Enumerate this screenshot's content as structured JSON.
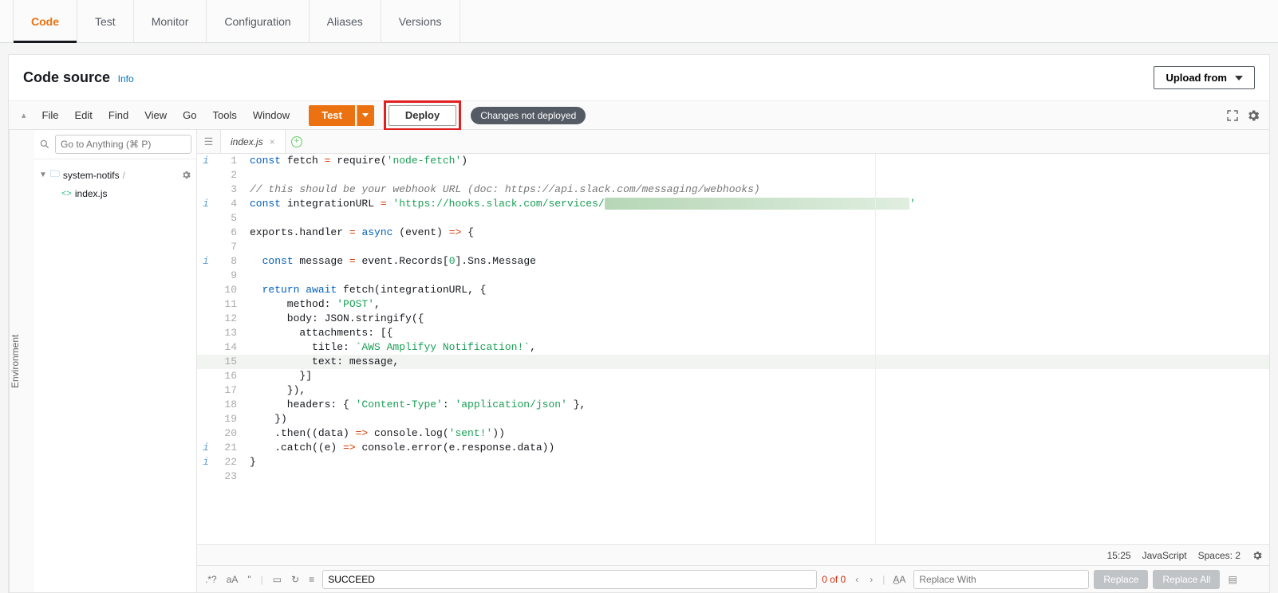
{
  "top_tabs": {
    "items": [
      "Code",
      "Test",
      "Monitor",
      "Configuration",
      "Aliases",
      "Versions"
    ],
    "active": "Code"
  },
  "panel": {
    "title": "Code source",
    "info_label": "Info",
    "upload_label": "Upload from"
  },
  "ide_menu": {
    "items": [
      "File",
      "Edit",
      "Find",
      "View",
      "Go",
      "Tools",
      "Window"
    ],
    "test_label": "Test",
    "deploy_label": "Deploy",
    "status_label": "Changes not deployed"
  },
  "sidebar": {
    "env_tab_label": "Environment",
    "search_placeholder": "Go to Anything (⌘ P)",
    "root_folder": "system-notifs",
    "files": [
      "index.js"
    ]
  },
  "editor": {
    "open_tab": "index.js",
    "cursor": "15:25",
    "language": "JavaScript",
    "spaces": "Spaces: 2",
    "code_lines": [
      {
        "n": 1,
        "info": "i",
        "html": "<span class='tok-kw'>const</span> fetch <span class='tok-op'>=</span> require(<span class='tok-str'>'node-fetch'</span>)"
      },
      {
        "n": 2,
        "info": "",
        "html": ""
      },
      {
        "n": 3,
        "info": "",
        "html": "<span class='tok-cmt'>// this should be your webhook URL (doc: https://api.slack.com/messaging/webhooks)</span>"
      },
      {
        "n": 4,
        "info": "i",
        "html": "<span class='tok-kw'>const</span> integrationURL <span class='tok-op'>=</span> <span class='tok-str'>'https://hooks.slack.com/services/</span><span class='redact'>XXXXXXXXXXXXXXXXXXXXXXXXXXXXXXXXXXXXXXXXXXXXXXXXX</span><span class='tok-str'>'</span>"
      },
      {
        "n": 5,
        "info": "",
        "html": ""
      },
      {
        "n": 6,
        "info": "",
        "html": "exports.handler <span class='tok-op'>=</span> <span class='tok-kw'>async</span> (event) <span class='tok-op'>=&gt;</span> {"
      },
      {
        "n": 7,
        "info": "",
        "html": ""
      },
      {
        "n": 8,
        "info": "i",
        "html": "  <span class='tok-kw'>const</span> message <span class='tok-op'>=</span> event.Records[<span class='tok-num'>0</span>].Sns.Message"
      },
      {
        "n": 9,
        "info": "",
        "html": ""
      },
      {
        "n": 10,
        "info": "",
        "html": "  <span class='tok-kw'>return</span> <span class='tok-kw'>await</span> fetch(integrationURL, {"
      },
      {
        "n": 11,
        "info": "",
        "html": "      method: <span class='tok-str'>'POST'</span>,"
      },
      {
        "n": 12,
        "info": "",
        "html": "      body: JSON.stringify({"
      },
      {
        "n": 13,
        "info": "",
        "html": "        attachments: [{"
      },
      {
        "n": 14,
        "info": "",
        "html": "          title: <span class='tok-str'>`AWS Amplifyy Notification!`</span>,"
      },
      {
        "n": 15,
        "info": "",
        "html": "          text: message,",
        "hl": true
      },
      {
        "n": 16,
        "info": "",
        "html": "        }]"
      },
      {
        "n": 17,
        "info": "",
        "html": "      }),"
      },
      {
        "n": 18,
        "info": "",
        "html": "      headers: { <span class='tok-str'>'Content-Type'</span>: <span class='tok-str'>'application/json'</span> },"
      },
      {
        "n": 19,
        "info": "",
        "html": "    })"
      },
      {
        "n": 20,
        "info": "",
        "html": "    .then((data) <span class='tok-op'>=&gt;</span> console.log(<span class='tok-str'>'sent!'</span>))"
      },
      {
        "n": 21,
        "info": "i",
        "html": "    .catch((e) <span class='tok-op'>=&gt;</span> console.error(e.response.data))"
      },
      {
        "n": 22,
        "info": "i",
        "html": "}"
      },
      {
        "n": 23,
        "info": "",
        "html": ""
      }
    ]
  },
  "find": {
    "query": "SUCCEED",
    "count_label": "0 of 0",
    "replace_placeholder": "Replace With",
    "replace_label": "Replace",
    "replace_all_label": "Replace All"
  }
}
